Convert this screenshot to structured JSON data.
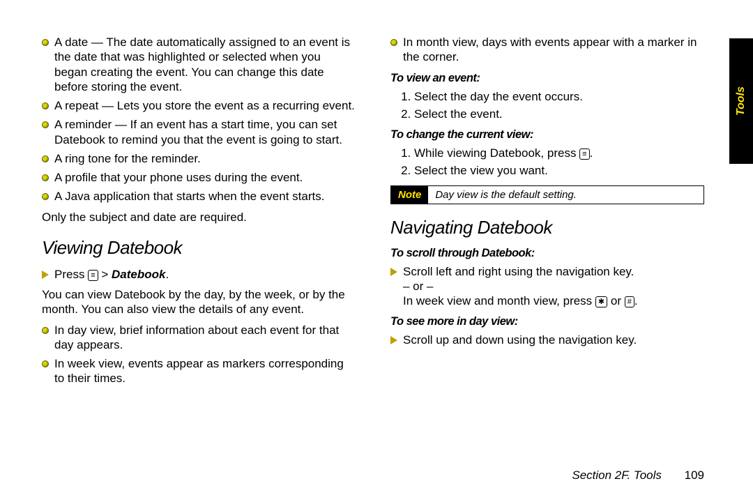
{
  "sideTab": "Tools",
  "left": {
    "bullets1": [
      "A date — The date automatically assigned to an event is the date that was highlighted or selected when you began creating the event. You can change this date before storing the event.",
      "A repeat — Lets you store the event as a recurring event.",
      "A reminder — If an event has a start time, you can set Datebook to remind you that the event is going to start.",
      "A ring tone for the reminder.",
      "A profile that your phone uses during the event.",
      "A Java application that starts when the event starts."
    ],
    "plain1": "Only the subject and date are required.",
    "h1": "Viewing Datebook",
    "step_pre": "Press ",
    "step_post": " > ",
    "step_dest": "Datebook",
    "step_end": ".",
    "plain2": "You can view Datebook by the day, by the week, or by the month. You can also view the details of any event.",
    "bullets2": [
      "In day view, brief information about each event for that day appears.",
      "In week view, events appear as markers corresponding to their times."
    ]
  },
  "right": {
    "bullets1": [
      "In month view, days with events appear with a marker in the corner."
    ],
    "sub1": "To view an event:",
    "ol1": [
      "Select the day the event occurs.",
      "Select the event."
    ],
    "sub2": "To change the current view:",
    "ol2_a": "While viewing Datebook, press ",
    "ol2_a_end": ".",
    "ol2_b": "Select the view you want.",
    "noteLabel": "Note",
    "noteText": "Day view is the default setting.",
    "h2": "Navigating Datebook",
    "sub3": "To scroll through Datebook:",
    "nav1_a": "Scroll left and right using the navigation key.",
    "nav1_or": "– or –",
    "nav1_b_pre": "In week view and month view, press ",
    "nav1_b_mid": " or ",
    "nav1_b_end": ".",
    "sub4": "To see more in day view:",
    "nav2": "Scroll up and down using the navigation key."
  },
  "footer": {
    "section": "Section 2F. Tools",
    "page": "109"
  },
  "keys": {
    "menu": "≡",
    "star": "✱",
    "hash": "#"
  }
}
